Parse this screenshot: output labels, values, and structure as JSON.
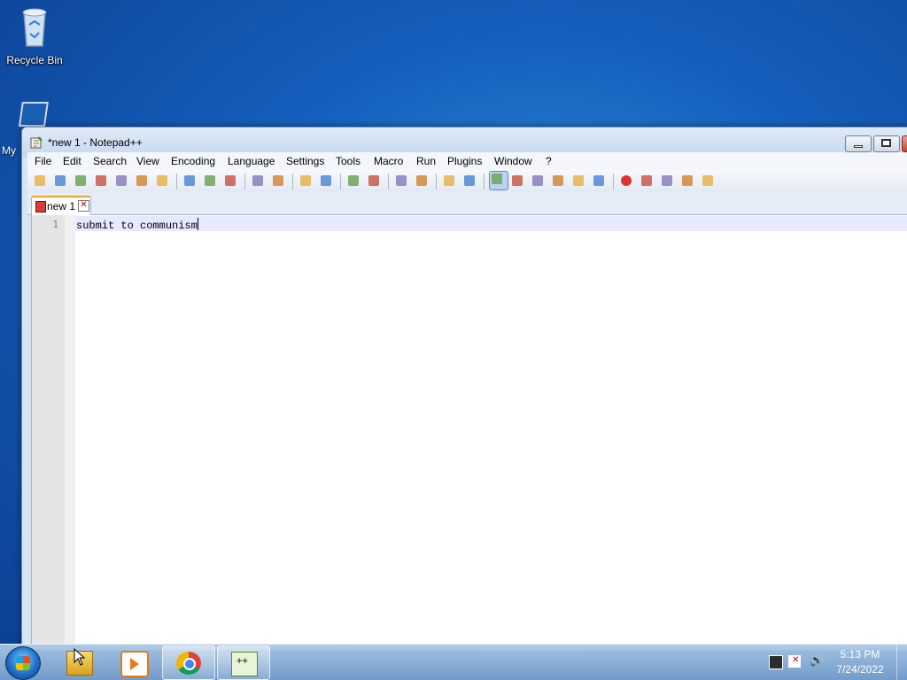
{
  "desktop": {
    "recycle_bin_label": "Recycle Bin",
    "computer_label_partial": "My"
  },
  "window": {
    "title": "*new 1 - Notepad++",
    "menus": [
      "File",
      "Edit",
      "Search",
      "View",
      "Encoding",
      "Language",
      "Settings",
      "Tools",
      "Macro",
      "Run",
      "Plugins",
      "Window",
      "?"
    ],
    "toolbar_icons": [
      "new-file-icon",
      "open-file-icon",
      "save-icon",
      "save-all-icon",
      "close-icon",
      "close-all-icon",
      "print-icon",
      "cut-icon",
      "copy-icon",
      "paste-icon",
      "undo-icon",
      "redo-icon",
      "find-icon",
      "replace-icon",
      "zoom-in-icon",
      "zoom-out-icon",
      "sync-vertical-icon",
      "sync-horizontal-icon",
      "word-wrap-icon",
      "show-all-characters-icon",
      "indent-guide-icon",
      "user-language-icon",
      "document-map-icon",
      "function-list-icon",
      "folder-as-workspace-icon",
      "monitoring-icon",
      "record-macro-icon",
      "stop-macro-icon",
      "play-macro-icon",
      "run-macro-multiple-icon",
      "save-macro-icon"
    ],
    "active_tab": {
      "label": "new 1",
      "close_glyph": "✕"
    },
    "editor": {
      "line_number": "1",
      "line_text": "submit to communism"
    }
  },
  "taskbar": {
    "apps": [
      "windows-explorer",
      "windows-media-player",
      "google-chrome",
      "notepad-plus-plus"
    ],
    "clock_time": "5:13 PM",
    "clock_date": "7/24/2022",
    "volume_glyph": "🔊"
  },
  "colors": {
    "desktop_blue": "#1560bd",
    "titlebar": "#c5d8ee",
    "current_line": "#e8e8ff",
    "gutter": "#e4e4e4",
    "tab_accent": "#f0a030"
  }
}
